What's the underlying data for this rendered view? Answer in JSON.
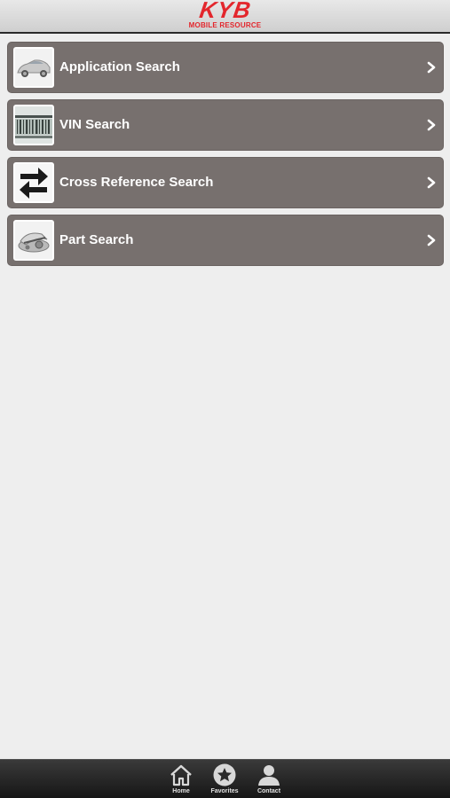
{
  "header": {
    "logo_main": "KYB",
    "logo_sub": "MOBILE RESOURCE",
    "brand_color": "#e3262c"
  },
  "menu": {
    "items": [
      {
        "label": "Application Search",
        "icon": "car-icon"
      },
      {
        "label": "VIN Search",
        "icon": "barcode-icon"
      },
      {
        "label": "Cross Reference Search",
        "icon": "swap-arrows-icon"
      },
      {
        "label": "Part Search",
        "icon": "shock-part-icon"
      }
    ],
    "item_color": "#77706e"
  },
  "tabbar": {
    "tabs": [
      {
        "label": "Home",
        "icon": "home-icon"
      },
      {
        "label": "Favorites",
        "icon": "star-icon"
      },
      {
        "label": "Contact",
        "icon": "person-icon"
      }
    ]
  }
}
